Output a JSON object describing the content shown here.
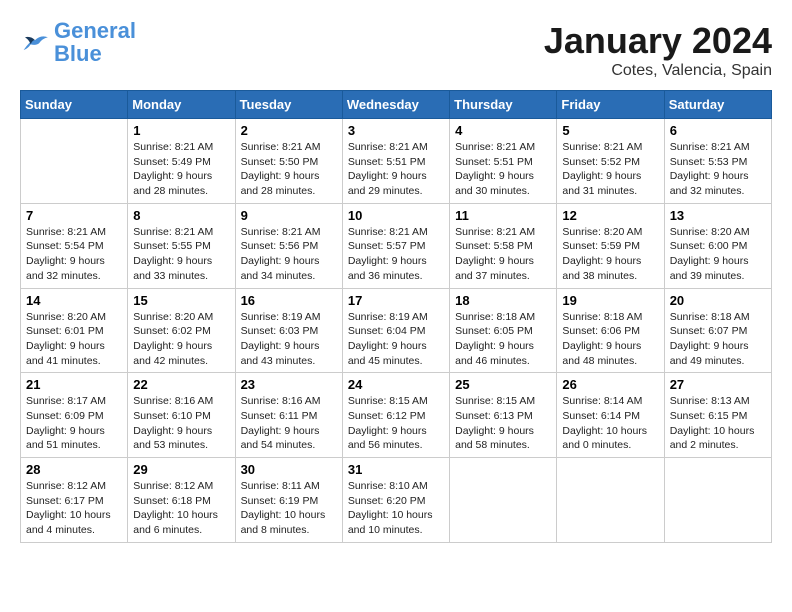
{
  "logo": {
    "general": "General",
    "blue": "Blue"
  },
  "header": {
    "title": "January 2024",
    "subtitle": "Cotes, Valencia, Spain"
  },
  "weekdays": [
    "Sunday",
    "Monday",
    "Tuesday",
    "Wednesday",
    "Thursday",
    "Friday",
    "Saturday"
  ],
  "weeks": [
    [
      {
        "day": "",
        "info": ""
      },
      {
        "day": "1",
        "info": "Sunrise: 8:21 AM\nSunset: 5:49 PM\nDaylight: 9 hours\nand 28 minutes."
      },
      {
        "day": "2",
        "info": "Sunrise: 8:21 AM\nSunset: 5:50 PM\nDaylight: 9 hours\nand 28 minutes."
      },
      {
        "day": "3",
        "info": "Sunrise: 8:21 AM\nSunset: 5:51 PM\nDaylight: 9 hours\nand 29 minutes."
      },
      {
        "day": "4",
        "info": "Sunrise: 8:21 AM\nSunset: 5:51 PM\nDaylight: 9 hours\nand 30 minutes."
      },
      {
        "day": "5",
        "info": "Sunrise: 8:21 AM\nSunset: 5:52 PM\nDaylight: 9 hours\nand 31 minutes."
      },
      {
        "day": "6",
        "info": "Sunrise: 8:21 AM\nSunset: 5:53 PM\nDaylight: 9 hours\nand 32 minutes."
      }
    ],
    [
      {
        "day": "7",
        "info": "Sunrise: 8:21 AM\nSunset: 5:54 PM\nDaylight: 9 hours\nand 32 minutes."
      },
      {
        "day": "8",
        "info": "Sunrise: 8:21 AM\nSunset: 5:55 PM\nDaylight: 9 hours\nand 33 minutes."
      },
      {
        "day": "9",
        "info": "Sunrise: 8:21 AM\nSunset: 5:56 PM\nDaylight: 9 hours\nand 34 minutes."
      },
      {
        "day": "10",
        "info": "Sunrise: 8:21 AM\nSunset: 5:57 PM\nDaylight: 9 hours\nand 36 minutes."
      },
      {
        "day": "11",
        "info": "Sunrise: 8:21 AM\nSunset: 5:58 PM\nDaylight: 9 hours\nand 37 minutes."
      },
      {
        "day": "12",
        "info": "Sunrise: 8:20 AM\nSunset: 5:59 PM\nDaylight: 9 hours\nand 38 minutes."
      },
      {
        "day": "13",
        "info": "Sunrise: 8:20 AM\nSunset: 6:00 PM\nDaylight: 9 hours\nand 39 minutes."
      }
    ],
    [
      {
        "day": "14",
        "info": "Sunrise: 8:20 AM\nSunset: 6:01 PM\nDaylight: 9 hours\nand 41 minutes."
      },
      {
        "day": "15",
        "info": "Sunrise: 8:20 AM\nSunset: 6:02 PM\nDaylight: 9 hours\nand 42 minutes."
      },
      {
        "day": "16",
        "info": "Sunrise: 8:19 AM\nSunset: 6:03 PM\nDaylight: 9 hours\nand 43 minutes."
      },
      {
        "day": "17",
        "info": "Sunrise: 8:19 AM\nSunset: 6:04 PM\nDaylight: 9 hours\nand 45 minutes."
      },
      {
        "day": "18",
        "info": "Sunrise: 8:18 AM\nSunset: 6:05 PM\nDaylight: 9 hours\nand 46 minutes."
      },
      {
        "day": "19",
        "info": "Sunrise: 8:18 AM\nSunset: 6:06 PM\nDaylight: 9 hours\nand 48 minutes."
      },
      {
        "day": "20",
        "info": "Sunrise: 8:18 AM\nSunset: 6:07 PM\nDaylight: 9 hours\nand 49 minutes."
      }
    ],
    [
      {
        "day": "21",
        "info": "Sunrise: 8:17 AM\nSunset: 6:09 PM\nDaylight: 9 hours\nand 51 minutes."
      },
      {
        "day": "22",
        "info": "Sunrise: 8:16 AM\nSunset: 6:10 PM\nDaylight: 9 hours\nand 53 minutes."
      },
      {
        "day": "23",
        "info": "Sunrise: 8:16 AM\nSunset: 6:11 PM\nDaylight: 9 hours\nand 54 minutes."
      },
      {
        "day": "24",
        "info": "Sunrise: 8:15 AM\nSunset: 6:12 PM\nDaylight: 9 hours\nand 56 minutes."
      },
      {
        "day": "25",
        "info": "Sunrise: 8:15 AM\nSunset: 6:13 PM\nDaylight: 9 hours\nand 58 minutes."
      },
      {
        "day": "26",
        "info": "Sunrise: 8:14 AM\nSunset: 6:14 PM\nDaylight: 10 hours\nand 0 minutes."
      },
      {
        "day": "27",
        "info": "Sunrise: 8:13 AM\nSunset: 6:15 PM\nDaylight: 10 hours\nand 2 minutes."
      }
    ],
    [
      {
        "day": "28",
        "info": "Sunrise: 8:12 AM\nSunset: 6:17 PM\nDaylight: 10 hours\nand 4 minutes."
      },
      {
        "day": "29",
        "info": "Sunrise: 8:12 AM\nSunset: 6:18 PM\nDaylight: 10 hours\nand 6 minutes."
      },
      {
        "day": "30",
        "info": "Sunrise: 8:11 AM\nSunset: 6:19 PM\nDaylight: 10 hours\nand 8 minutes."
      },
      {
        "day": "31",
        "info": "Sunrise: 8:10 AM\nSunset: 6:20 PM\nDaylight: 10 hours\nand 10 minutes."
      },
      {
        "day": "",
        "info": ""
      },
      {
        "day": "",
        "info": ""
      },
      {
        "day": "",
        "info": ""
      }
    ]
  ]
}
